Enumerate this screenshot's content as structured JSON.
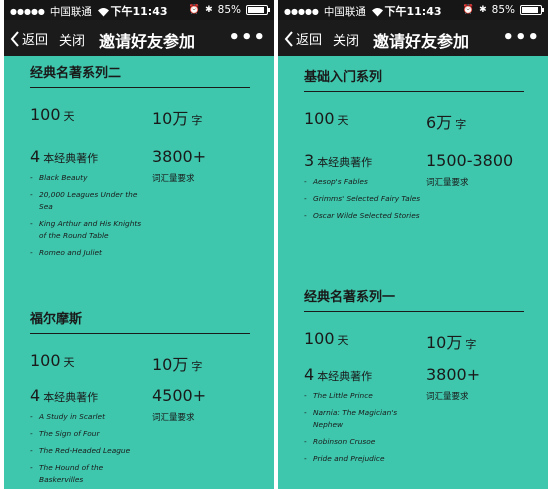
{
  "status_bar": {
    "carrier": "中国联通",
    "time": "下午11:43",
    "battery": "85%"
  },
  "nav": {
    "back_label": "返回",
    "close_label": "关闭",
    "title": "邀请好友参加",
    "more": "•••"
  },
  "left": {
    "s1": {
      "title": "经典名著系列二",
      "days": "100",
      "days_unit": "天",
      "words": "10万",
      "words_unit": "字",
      "books_count": "4",
      "books_unit": "本经典著作",
      "vocab": "3800+",
      "vocab_label": "词汇量要求",
      "books": [
        "Black Beauty",
        "20,000 Leagues Under the Sea",
        "King Arthur and His Knights of the Round Table",
        "Romeo and Juliet"
      ]
    },
    "s2": {
      "title": "福尔摩斯",
      "days": "100",
      "days_unit": "天",
      "words": "10万",
      "words_unit": "字",
      "books_count": "4",
      "books_unit": "本经典著作",
      "vocab": "4500+",
      "vocab_label": "词汇量要求",
      "books": [
        "A Study in Scarlet",
        "The Sign of Four",
        "The Red-Headed League",
        "The Hound of the Baskervilles"
      ]
    }
  },
  "right": {
    "s1": {
      "title": "基础入门系列",
      "days": "100",
      "days_unit": "天",
      "words": "6万",
      "words_unit": "字",
      "books_count": "3",
      "books_unit": "本经典著作",
      "vocab": "1500-3800",
      "vocab_label": "词汇量要求",
      "books": [
        "Aesop's Fables",
        "Grimms' Selected Fairy Tales",
        "Oscar Wilde Selected Stories"
      ]
    },
    "s2": {
      "title": "经典名著系列一",
      "days": "100",
      "days_unit": "天",
      "words": "10万",
      "words_unit": "字",
      "books_count": "4",
      "books_unit": "本经典著作",
      "vocab": "3800+",
      "vocab_label": "词汇量要求",
      "books": [
        "The Little Prince",
        "Narnia: The Magician's Nephew",
        "Robinson Crusoe",
        "Pride and Prejudice"
      ]
    }
  }
}
